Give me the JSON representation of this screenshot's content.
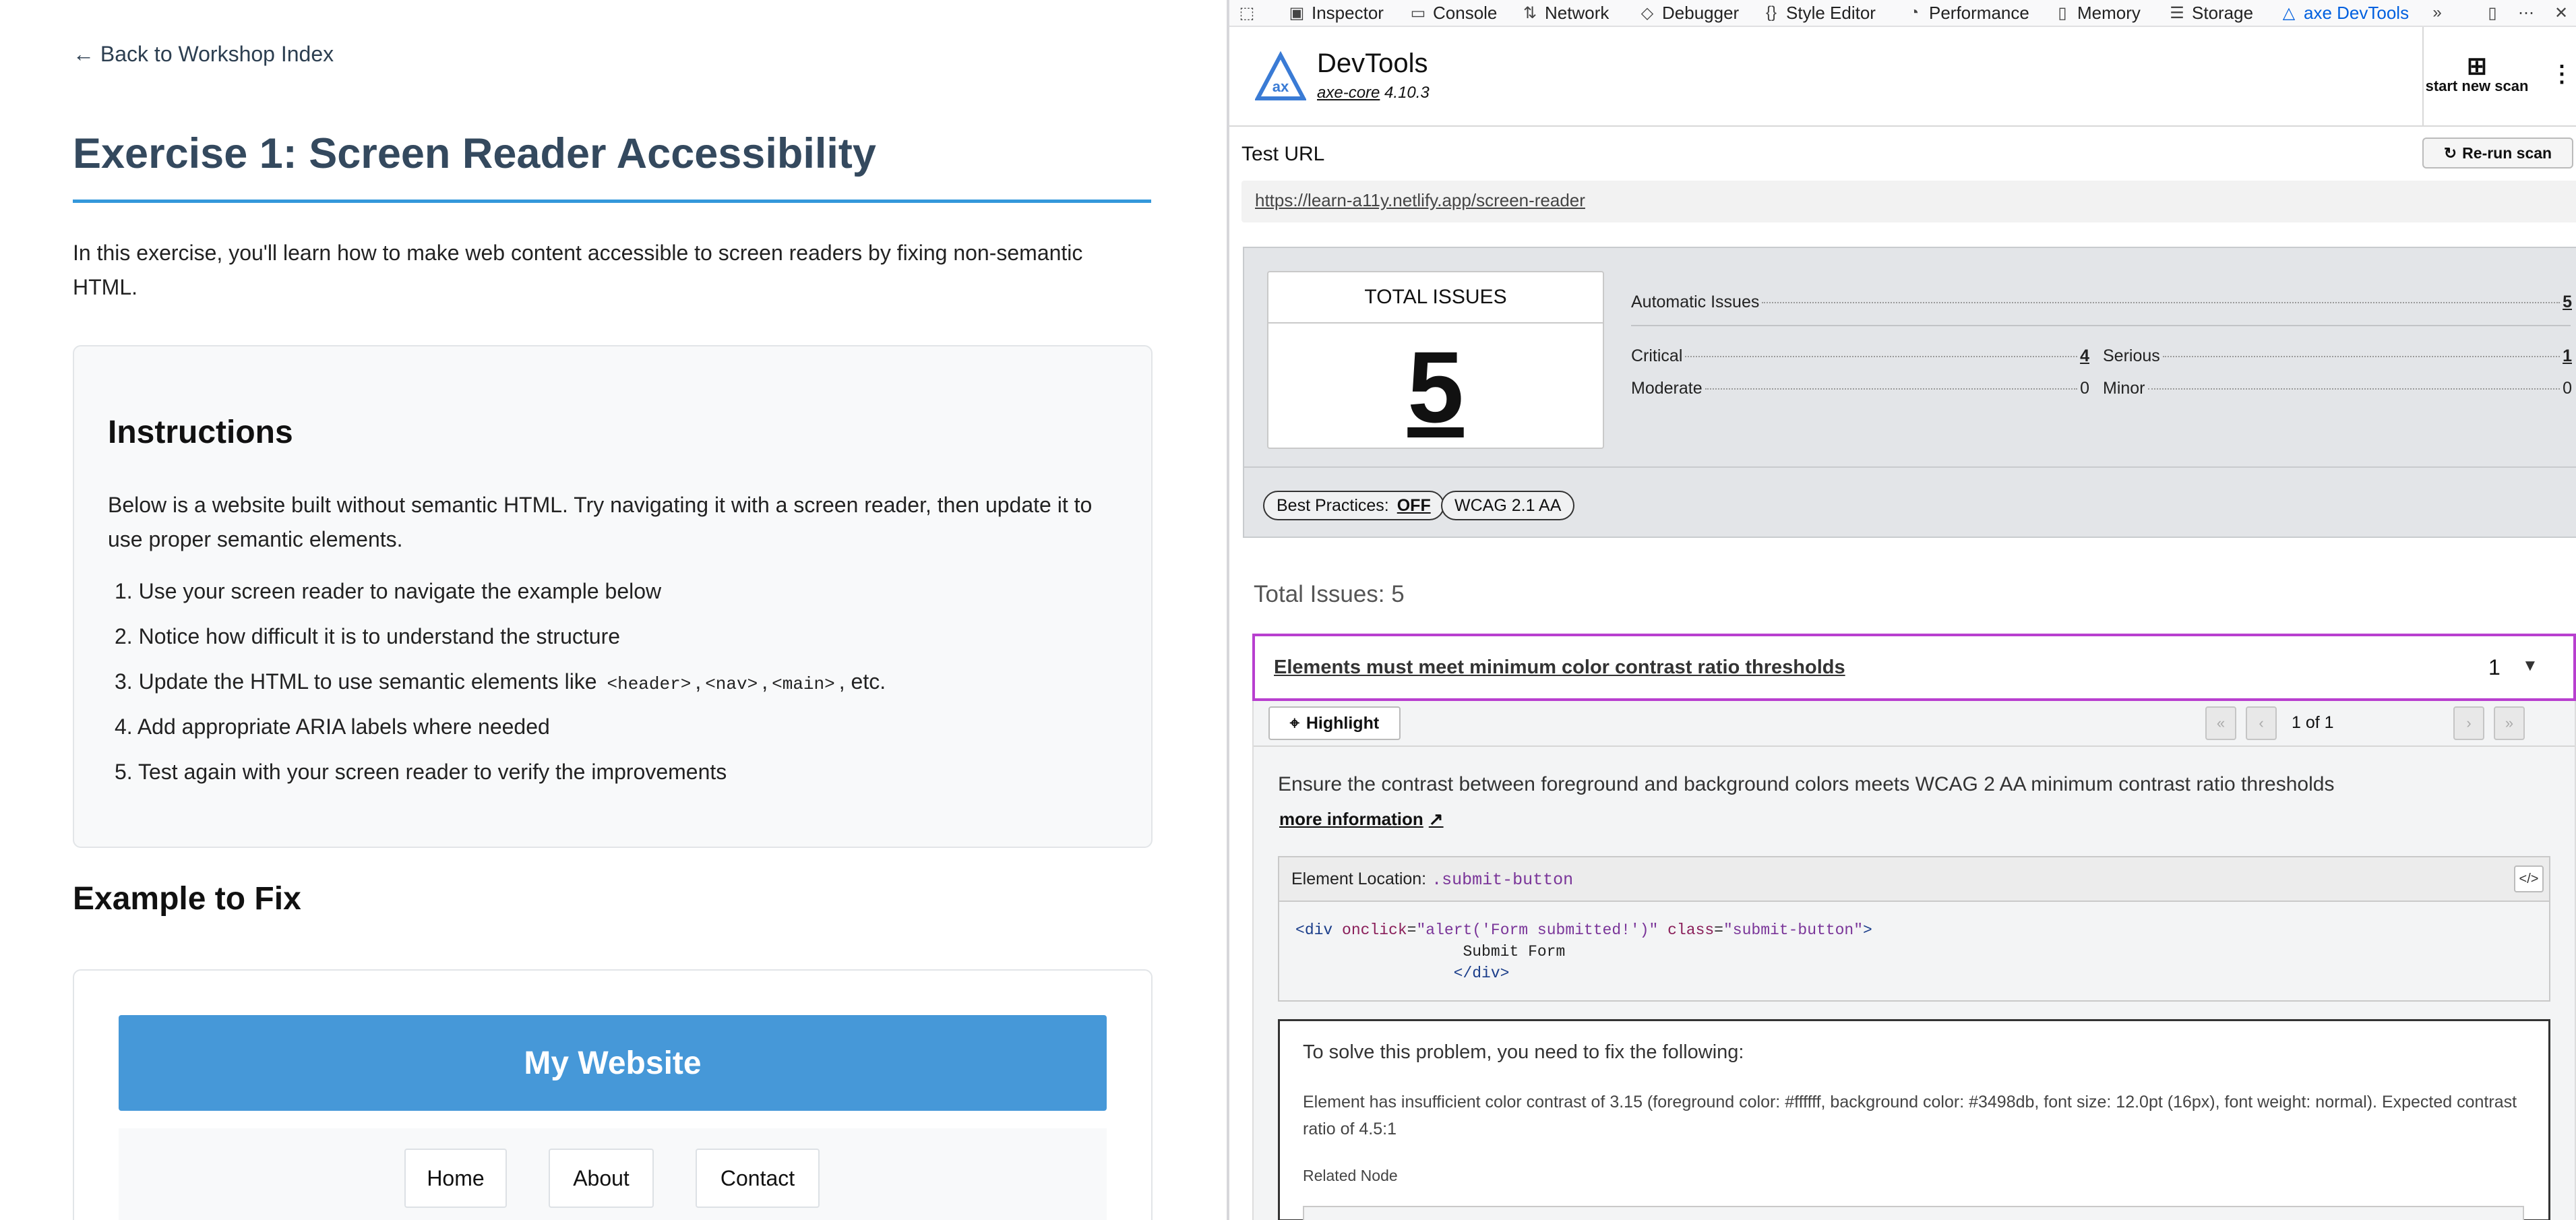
{
  "left": {
    "back_link": "← Back to Workshop Index",
    "title": "Exercise 1: Screen Reader Accessibility",
    "intro": "In this exercise, you'll learn how to make web content accessible to screen readers by fixing non-semantic HTML.",
    "instructions_title": "Instructions",
    "instructions_text": "Below is a website built without semantic HTML. Try navigating it with a screen reader, then update it to use proper semantic elements.",
    "steps": [
      "1. Use your screen reader to navigate the example below",
      "2. Notice how difficult it is to understand the structure",
      "3. Update the HTML to use semantic elements like ",
      "4. Add appropriate ARIA labels where needed",
      "5. Test again with your screen reader to verify the improvements"
    ],
    "step3_codes": [
      "<header>",
      "<nav>",
      "<main>"
    ],
    "step3_sep": ",",
    "step3_suffix": ", etc.",
    "example_title": "Example to Fix",
    "site_title": "My Website",
    "nav": [
      "Home",
      "About",
      "Contact"
    ]
  },
  "devtools": {
    "tabs": [
      {
        "label": "Inspector",
        "icon": "inspector-icon"
      },
      {
        "label": "Console",
        "icon": "console-icon"
      },
      {
        "label": "Network",
        "icon": "network-icon"
      },
      {
        "label": "Debugger",
        "icon": "debugger-icon"
      },
      {
        "label": "Style Editor",
        "icon": "style-editor-icon"
      },
      {
        "label": "Performance",
        "icon": "performance-icon"
      },
      {
        "label": "Memory",
        "icon": "memory-icon"
      },
      {
        "label": "Storage",
        "icon": "storage-icon"
      },
      {
        "label": "axe DevTools",
        "icon": "axe-icon",
        "active": true
      }
    ],
    "active_color": "#0060df"
  },
  "axe": {
    "brand": "DevTools",
    "core_name": "axe-core",
    "core_version": "4.10.3",
    "new_scan": "start new scan",
    "test_url_label": "Test URL",
    "rerun": "Re-run scan",
    "url": "https://learn-a11y.netlify.app/screen-reader",
    "total_label": "TOTAL ISSUES",
    "total": "5",
    "automatic_label": "Automatic Issues",
    "automatic": "5",
    "critical_label": "Critical",
    "critical": "4",
    "serious_label": "Serious",
    "serious": "1",
    "moderate_label": "Moderate",
    "moderate": "0",
    "minor_label": "Minor",
    "minor": "0",
    "best_practices_label": "Best Practices:",
    "best_practices_value": "OFF",
    "wcag": "WCAG 2.1 AA",
    "issues_title": "Total Issues: 5",
    "issue": {
      "title": "Elements must meet minimum color contrast ratio thresholds",
      "count": "1",
      "highlight": "Highlight",
      "pager": "1 of 1",
      "description": "Ensure the contrast between foreground and background colors meets WCAG 2 AA minimum contrast ratio thresholds",
      "more_info": "more information",
      "location_label": "Element Location:",
      "location": ".submit-button",
      "code_line1_open": "<",
      "code_tag": "div",
      "code_attr1": "onclick",
      "code_val1": "\"alert('Form submitted!')\"",
      "code_attr2": "class",
      "code_val2": "\"submit-button\"",
      "code_line2": "Submit Form",
      "code_line3": "</div>",
      "fix_title": "To solve this problem, you need to fix the following:",
      "fix_text": "Element has insufficient color contrast of 3.15 (foreground color: #ffffff, background color: #3498db, font size: 12.0pt (16px), font weight: normal). Expected contrast ratio of 4.5:1",
      "related": "Related Node"
    },
    "highlight_color": "#b83fcf"
  }
}
